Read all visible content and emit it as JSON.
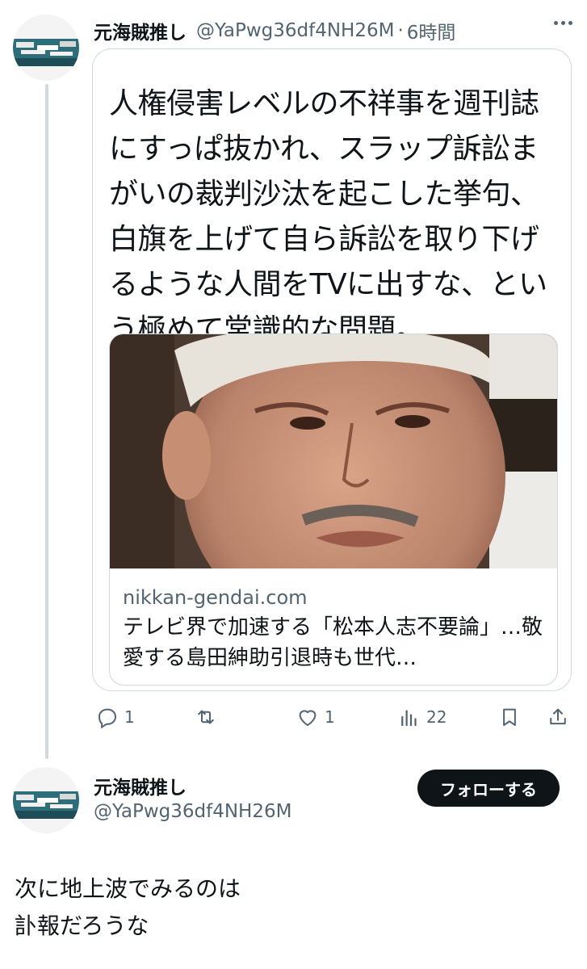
{
  "quoted_post": {
    "author_name": "元海賊推し",
    "handle": "@YaPwg36df4NH26M",
    "separator": "·",
    "time": "6時間",
    "text": "人権侵害レベルの不祥事を週刊誌にすっぱ抜かれ、スラップ訴訟まがいの裁判沙汰を起こした挙句、白旗を上げて自ら訴訟を取り下げるような人間をTVに出すな、という極めて常識的な問題。",
    "link_card": {
      "domain": "nikkan-gendai.com",
      "title": "テレビ界で加速する「松本人志不要論」…敬愛する島田紳助引退時も世代…"
    },
    "actions": {
      "reply_count": "1",
      "repost_count": "",
      "like_count": "1",
      "views_count": "22"
    }
  },
  "reply_post": {
    "author_name": "元海賊推し",
    "handle": "@YaPwg36df4NH26M",
    "follow_label": "フォローする",
    "text_line1": "次に地上波でみるのは",
    "text_line2": "訃報だろうな"
  },
  "colors": {
    "text_primary": "#0f1419",
    "text_secondary": "#536471",
    "border": "#cfd9de",
    "follow_bg": "#0f1419"
  }
}
